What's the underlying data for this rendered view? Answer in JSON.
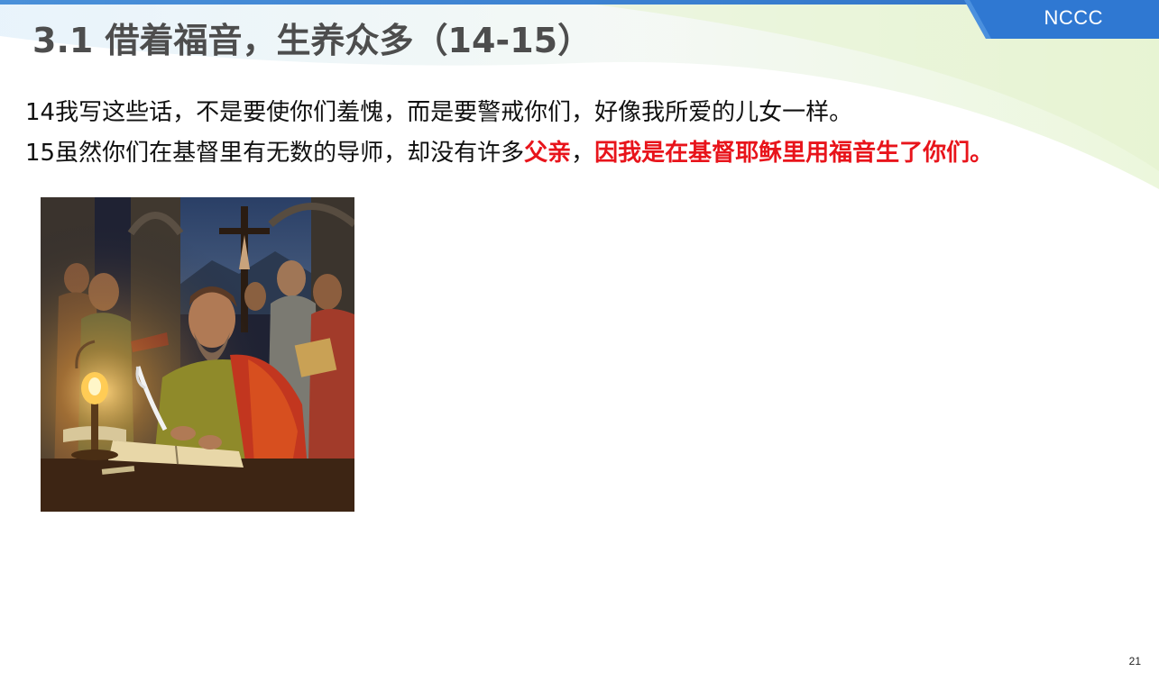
{
  "slide": {
    "title": "3.1 借着福音，生养众多（14-15）",
    "brand": "NCCC",
    "page_number": "21"
  },
  "verses": {
    "v14": "14我写这些话，不是要使你们羞愧，而是要警戒你们，好像我所爱的儿女一样。",
    "v15_part1": "15虽然你们在基督里有无数的导师，却没有许多",
    "v15_highlight1": "父亲",
    "v15_comma": "，",
    "v15_highlight2": "因我是在基督耶稣里用福音生了你们。"
  },
  "colors": {
    "title": "#4d4d4d",
    "highlight": "#e8141b",
    "brand_tab": "#2f78d2",
    "top_bar": "#3a7fd0"
  },
  "illustration": {
    "subject": "apostle writing by lamplight with quill, crucifix and onlookers"
  }
}
